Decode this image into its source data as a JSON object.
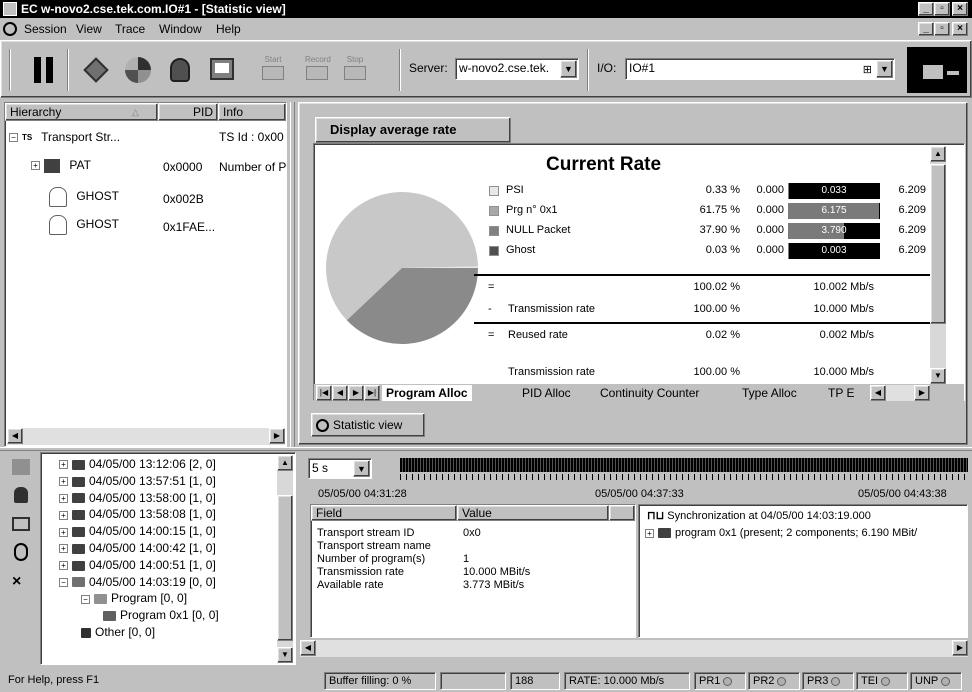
{
  "window": {
    "title": "EC w-novo2.cse.tek.com.IO#1 - [Statistic view]"
  },
  "menu": [
    {
      "label": "Session",
      "u": "S"
    },
    {
      "label": "View",
      "u": "V"
    },
    {
      "label": "Trace",
      "u": "T"
    },
    {
      "label": "Window",
      "u": "W"
    },
    {
      "label": "Help",
      "u": "H"
    }
  ],
  "toolbar": {
    "start_label": "Start",
    "record_label": "Record",
    "stop_label": "Stop",
    "server_label": "Server:",
    "server_value": "w-novo2.cse.tek.",
    "io_label": "I/O:",
    "io_value": "IO#1"
  },
  "hierarchy": {
    "columns": [
      "Hierarchy",
      "PID",
      "Info"
    ],
    "rows": [
      {
        "name": "Transport Str...",
        "pid": "",
        "info": "TS Id : 0x00"
      },
      {
        "name": "PAT",
        "pid": "0x0000",
        "info": "Number of P"
      },
      {
        "name": "GHOST",
        "pid": "0x002B",
        "info": ""
      },
      {
        "name": "GHOST",
        "pid": "0x1FAE...",
        "info": ""
      }
    ]
  },
  "stat": {
    "group_label": "Display average rate",
    "heading": "Current Rate",
    "rows": [
      {
        "name": "PSI",
        "pct": "0.33 %",
        "min": "0.000",
        "bar": "0.033",
        "max": "6.209",
        "fill": 0.005,
        "color": "#e8e8e8"
      },
      {
        "name": "Prg n° 0x1",
        "pct": "61.75 %",
        "min": "0.000",
        "bar": "6.175",
        "max": "6.209",
        "fill": 0.9945,
        "color": "#a8a8a8"
      },
      {
        "name": "NULL Packet",
        "pct": "37.90 %",
        "min": "0.000",
        "bar": "3.790",
        "max": "6.209",
        "fill": 0.6104,
        "color": "#808080"
      },
      {
        "name": "Ghost",
        "pct": "0.03 %",
        "min": "0.000",
        "bar": "0.003",
        "max": "6.209",
        "fill": 0.0005,
        "color": "#505050"
      }
    ],
    "total_sign": "=",
    "total_pct": "100.02 %",
    "total_rate": "10.002 Mb/s",
    "tx_sign": "-",
    "tx_label": "Transmission rate",
    "tx_pct": "100.00 %",
    "tx_rate": "10.000 Mb/s",
    "reused_sign": "=",
    "reused_label": "Reused rate",
    "reused_pct": "0.02 %",
    "reused_rate": "0.002 Mb/s",
    "tx2_label": "Transmission rate",
    "tx2_pct": "100.00 %",
    "tx2_rate": "10.000 Mb/s",
    "pie": [
      {
        "value": 0.33,
        "color": "#e8e8e8"
      },
      {
        "value": 61.75,
        "color": "#c8c8c8"
      },
      {
        "value": 37.9,
        "color": "#8a8a8a"
      },
      {
        "value": 0.03,
        "color": "#505050"
      }
    ],
    "tabs": [
      "Program Alloc",
      "PID Alloc",
      "Continuity Counter",
      "Type Alloc",
      "TP E"
    ],
    "window_tab": "Statistic view"
  },
  "events": [
    {
      "label": "04/05/00 13:12:06  [2, 0]"
    },
    {
      "label": "04/05/00 13:57:51  [1, 0]"
    },
    {
      "label": "04/05/00 13:58:00  [1, 0]"
    },
    {
      "label": "04/05/00 13:58:08  [1, 0]"
    },
    {
      "label": "04/05/00 14:00:15  [1, 0]"
    },
    {
      "label": "04/05/00 14:00:42  [1, 0]"
    },
    {
      "label": "04/05/00 14:00:51  [1, 0]"
    },
    {
      "label": "04/05/00 14:03:19  [0, 0]"
    },
    {
      "label": "Program  [0, 0]"
    },
    {
      "label": "Program 0x1  [0, 0]"
    },
    {
      "label": "Other  [0, 0]"
    }
  ],
  "timeline": {
    "interval": "5 s",
    "t1": "05/05/00 04:31:28",
    "t2": "05/05/00 04:37:33",
    "t3": "05/05/00 04:43:38"
  },
  "fields": {
    "columns": [
      "Field",
      "Value"
    ],
    "rows": [
      {
        "field": "Transport stream ID",
        "value": "0x0"
      },
      {
        "field": "Transport stream name",
        "value": ""
      },
      {
        "field": "Number of program(s)",
        "value": "1"
      },
      {
        "field": "Transmission rate",
        "value": "10.000 MBit/s"
      },
      {
        "field": "Available rate",
        "value": "3.773 MBit/s"
      }
    ]
  },
  "detail": [
    {
      "label": "Synchronization at 04/05/00 14:03:19.000"
    },
    {
      "label": "program 0x1 (present; 2 components; 6.190 MBit/"
    }
  ],
  "status": {
    "help": "For Help, press F1",
    "buffer": "Buffer filling: 0 %",
    "count": "188",
    "rate": "RATE: 10.000 Mb/s",
    "leds": [
      "PR1",
      "PR2",
      "PR3",
      "TEI",
      "UNP"
    ]
  }
}
